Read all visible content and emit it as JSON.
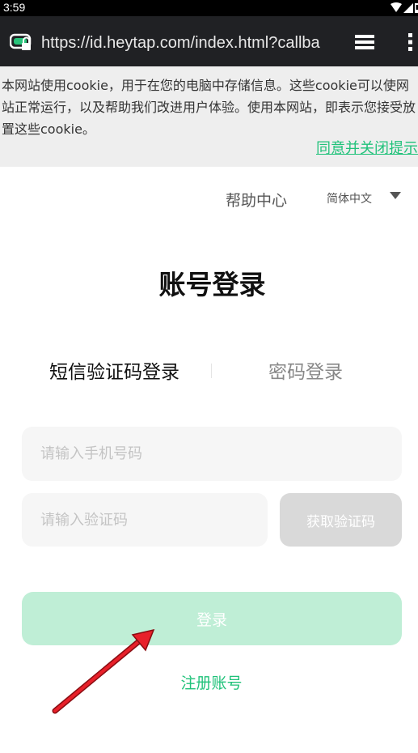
{
  "status_bar": {
    "time": "3:59",
    "icons": [
      "wifi-icon",
      "signal-icon",
      "battery-icon"
    ]
  },
  "browser": {
    "url": "https://id.heytap.com/index.html?callba",
    "icons": [
      "site-lock-icon",
      "tabs-icon",
      "overflow-menu-icon"
    ]
  },
  "cookie_banner": {
    "text": "本网站使用cookie，用于在您的电脑中存储信息。这些cookie可以使网站正常运行，以及帮助我们改进用户体验。使用本网站，即表示您接受放置这些cookie。",
    "close_label": "同意并关闭提示"
  },
  "header": {
    "help_label": "帮助中心",
    "language": "简体中文"
  },
  "login": {
    "title": "账号登录",
    "tabs": [
      {
        "label": "短信验证码登录",
        "active": true
      },
      {
        "label": "密码登录",
        "active": false
      }
    ],
    "phone_placeholder": "请输入手机号码",
    "code_placeholder": "请输入验证码",
    "get_code_label": "获取验证码",
    "submit_label": "登录",
    "register_label": "注册账号"
  },
  "colors": {
    "accent": "#20c27a",
    "login_button_disabled": "#bfeed6",
    "input_bg": "#f6f6f6",
    "get_code_disabled": "#d9d9d9",
    "annotation_arrow": "#e8202a"
  }
}
